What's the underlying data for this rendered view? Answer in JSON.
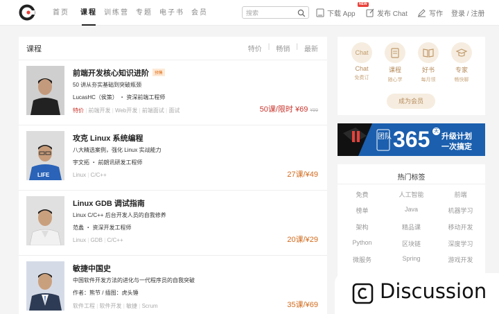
{
  "header": {
    "nav": [
      "首页",
      "课程",
      "训练营",
      "专题",
      "电子书",
      "会员"
    ],
    "active_index": 1,
    "search_placeholder": "搜索",
    "download_app": "下载 App",
    "new_badge": "NEW",
    "post_chat": "发布 Chat",
    "write": "写作",
    "login": "登录 / 注册"
  },
  "main": {
    "title": "课程",
    "sorts": [
      "特价",
      "畅销",
      "最新"
    ]
  },
  "courses": [
    {
      "title": "前端开发核心知识进阶",
      "badge": "预售",
      "desc": "50 讲从夯实基础到突破瓶颈",
      "author": "LucasHC（侯策） ・ 资深前端工程师",
      "tags": [
        "特价",
        "前端开发",
        "Web开发",
        "前端面试",
        "面试"
      ],
      "price": "50课/限时 ¥69",
      "orig_price": "¥99"
    },
    {
      "title": "攻克 Linux 系统编程",
      "desc": "八大精选案例，强化 Linux 实战能力",
      "author": "宇文拓 ・ 前朗讯研发工程师",
      "tags": [
        "Linux",
        "C/C++"
      ],
      "price": "27课/¥49"
    },
    {
      "title": "Linux GDB 调试指南",
      "desc": "Linux C/C++ 后台开发人员的自我修养",
      "author": "范蠡 ・ 资深开发工程师",
      "tags": [
        "Linux",
        "GDB",
        "C/C++"
      ],
      "price": "20课/¥29"
    },
    {
      "title": "敏捷中国史",
      "desc": "中国软件开发方法的进化与一代程序员的自我突破",
      "author": "作者：熊节 / 插图：虎头锤",
      "tags": [
        "软件工程",
        "软件开发",
        "敏捷",
        "Scrum"
      ],
      "price": "35课/¥69"
    }
  ],
  "perks": [
    {
      "icon": "Chat",
      "name": "Chat",
      "sub": "免费订"
    },
    {
      "icon": "",
      "name": "课程",
      "sub": "随心学"
    },
    {
      "icon": "",
      "name": "好书",
      "sub": "每月领"
    },
    {
      "icon": "",
      "name": "专家",
      "sub": "畅快聊"
    }
  ],
  "member_button": "成为会员",
  "banner": {
    "team": "团队",
    "number": "365",
    "day": "天",
    "line1": "升级计划",
    "line2": "一次搞定"
  },
  "hot_tags": {
    "title": "热门标签",
    "items": [
      "免费",
      "人工智能",
      "前端",
      "榜单",
      "Java",
      "机器学习",
      "架构",
      "精品课",
      "移动开发",
      "Python",
      "区块链",
      "深度学习",
      "微服务",
      "Spring",
      "游戏开发"
    ]
  },
  "discussion": "Discussion",
  "colors": {
    "accent": "#c9352d",
    "price": "#d26a1c",
    "gold": "#b58a5a",
    "banner_blue": "#1a5ba6"
  }
}
